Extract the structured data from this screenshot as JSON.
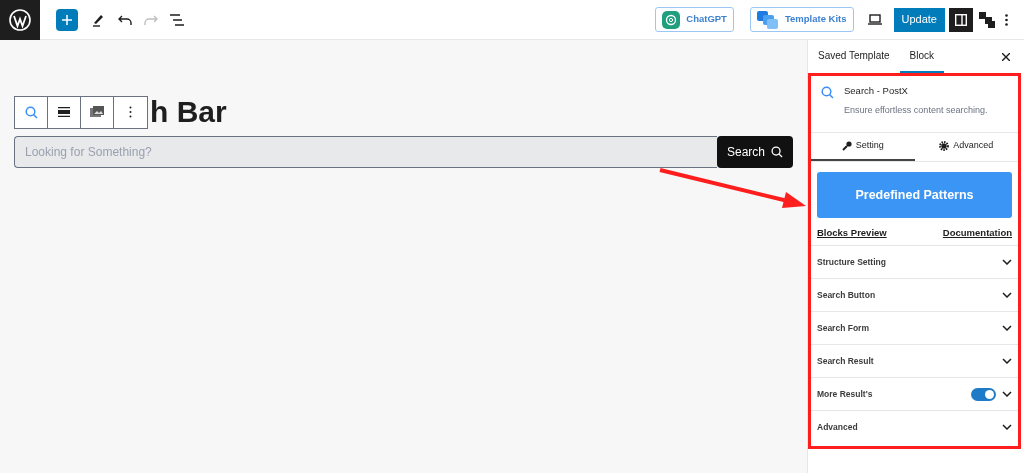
{
  "toolbar": {
    "right_buttons": [
      {
        "label": "ChatGPT",
        "kind": "chatgpt"
      },
      {
        "label": "Template Kits",
        "kind": "kits"
      }
    ],
    "update_label": "Update",
    "settings_panel_open": true
  },
  "canvas": {
    "heading": "h Bar",
    "search_placeholder": "Looking for Something?",
    "search_button": "Search"
  },
  "sidebar": {
    "tabs": [
      {
        "label": "Saved Template",
        "selected": false
      },
      {
        "label": "Block",
        "selected": true
      }
    ],
    "block": {
      "title": "Search - PostX",
      "description": "Ensure effortless content searching."
    },
    "sub_tabs": [
      {
        "label": "Setting",
        "kind": "wrench",
        "selected": true
      },
      {
        "label": "Advanced",
        "kind": "gear",
        "selected": false
      }
    ],
    "patterns_button": "Predefined Patterns",
    "links": [
      "Blocks Preview",
      "Documentation"
    ],
    "sections": [
      {
        "label": "Structure Setting",
        "kind": "plain"
      },
      {
        "label": "Search Button",
        "kind": "plain"
      },
      {
        "label": "Search Form",
        "kind": "plain"
      },
      {
        "label": "Search Result",
        "kind": "plain"
      },
      {
        "label": "More Result's",
        "kind": "toggle",
        "on": true
      },
      {
        "label": "Advanced",
        "kind": "plain"
      }
    ]
  }
}
